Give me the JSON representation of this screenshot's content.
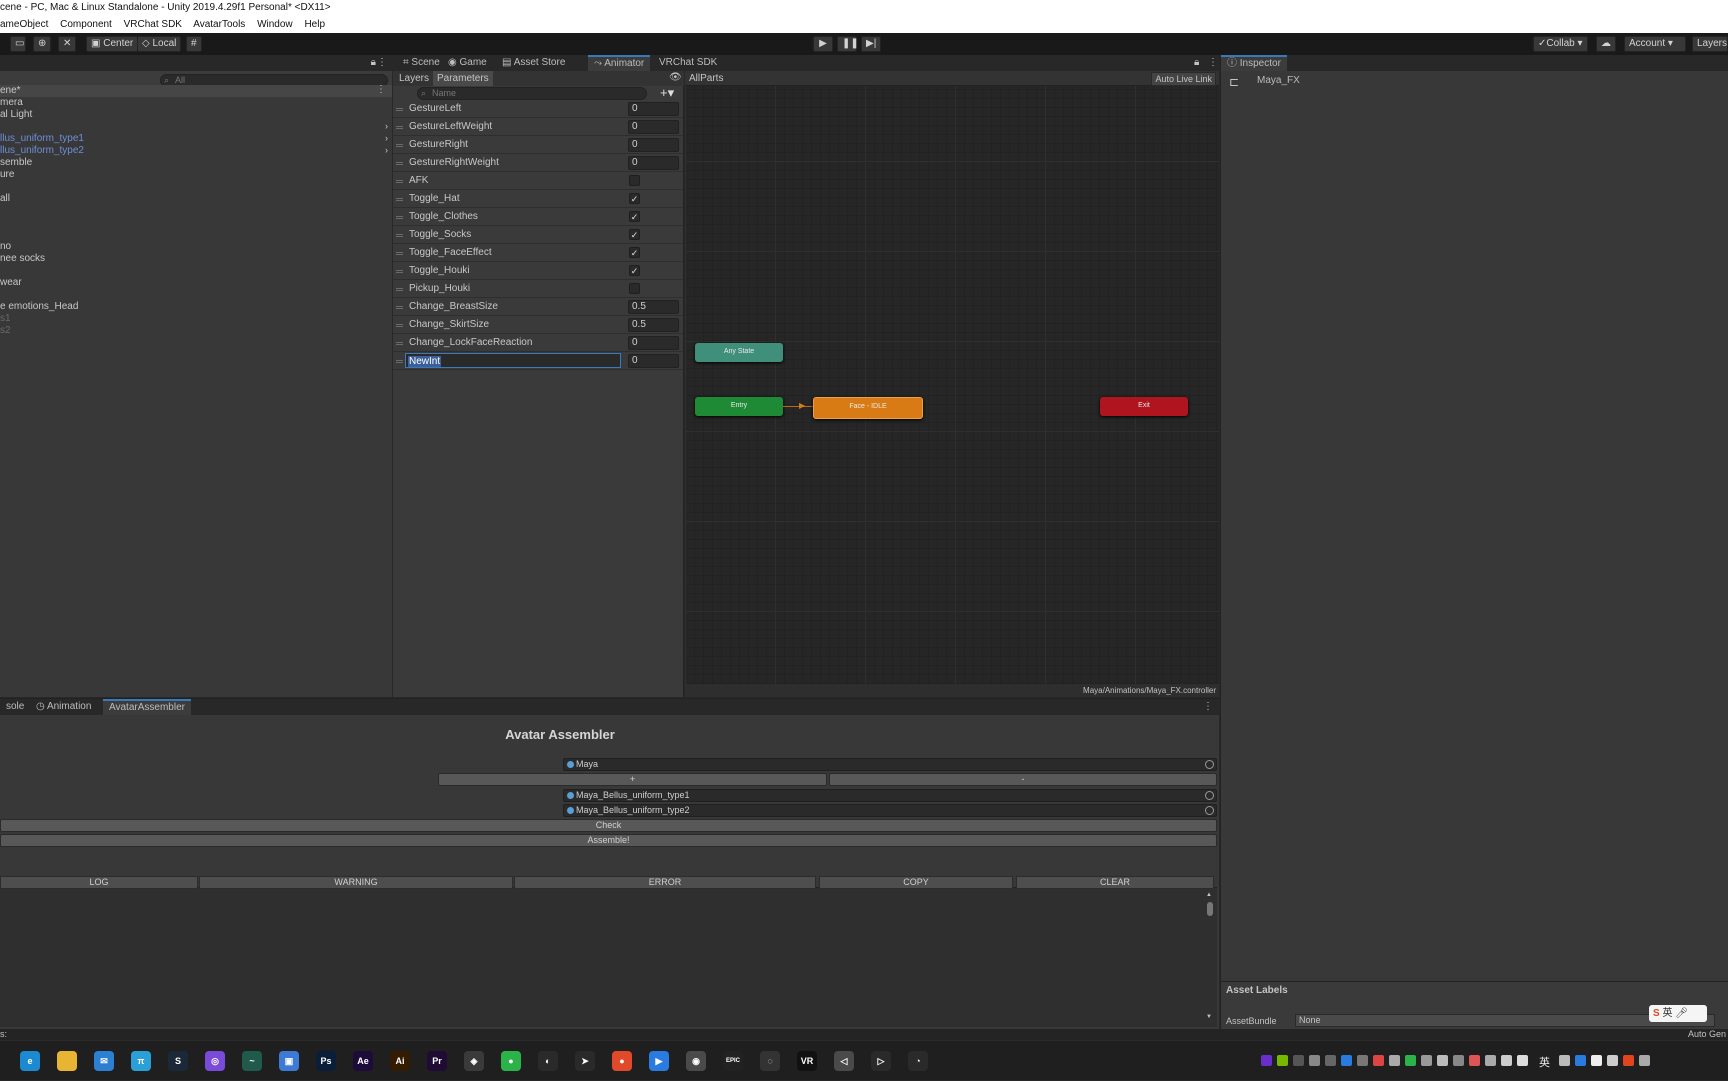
{
  "window": {
    "title": "cene - PC, Mac & Linux Standalone - Unity 2019.4.29f1 Personal* <DX11>"
  },
  "menu": [
    "ameObject",
    "Component",
    "VRChat SDK",
    "AvatarTools",
    "Window",
    "Help"
  ],
  "toolbar": {
    "pivot_center": "Center",
    "pivot_local": "Local",
    "collab": "Collab",
    "account": "Account",
    "layers": "Layers"
  },
  "hierarchy": {
    "search_placeholder": "All",
    "items": [
      {
        "label": "ene*",
        "style": "scene"
      },
      {
        "label": "mera",
        "style": "normal"
      },
      {
        "label": "al Light",
        "style": "normal"
      },
      {
        "label": "llus_uniform_type1",
        "style": "prefab"
      },
      {
        "label": "llus_uniform_type2",
        "style": "prefab"
      },
      {
        "label": "semble",
        "style": "normal"
      },
      {
        "label": "ure",
        "style": "normal"
      },
      {
        "label": "all",
        "style": "normal"
      },
      {
        "label": "no",
        "style": "normal"
      },
      {
        "label": "nee socks",
        "style": "normal"
      },
      {
        "label": "wear",
        "style": "normal"
      },
      {
        "label": "e emotions_Head",
        "style": "normal"
      },
      {
        "label": "s1",
        "style": "dim"
      },
      {
        "label": "s2",
        "style": "dim"
      }
    ]
  },
  "center_tabs": [
    "Scene",
    "Game",
    "Asset Store",
    "Animator",
    "VRChat SDK"
  ],
  "animator": {
    "subtabs": [
      "Layers",
      "Parameters"
    ],
    "search_placeholder": "Name",
    "breadcrumb": "AllParts",
    "auto_live_link": "Auto Live Link",
    "footer_path": "Maya/Animations/Maya_FX.controller",
    "parameters": [
      {
        "name": "GestureLeft",
        "type": "int",
        "value": "0"
      },
      {
        "name": "GestureLeftWeight",
        "type": "float",
        "value": "0"
      },
      {
        "name": "GestureRight",
        "type": "int",
        "value": "0"
      },
      {
        "name": "GestureRightWeight",
        "type": "float",
        "value": "0"
      },
      {
        "name": "AFK",
        "type": "bool",
        "value": ""
      },
      {
        "name": "Toggle_Hat",
        "type": "bool",
        "value": "✓"
      },
      {
        "name": "Toggle_Clothes",
        "type": "bool",
        "value": "✓"
      },
      {
        "name": "Toggle_Socks",
        "type": "bool",
        "value": "✓"
      },
      {
        "name": "Toggle_FaceEffect",
        "type": "bool",
        "value": "✓"
      },
      {
        "name": "Toggle_Houki",
        "type": "bool",
        "value": "✓"
      },
      {
        "name": "Pickup_Houki",
        "type": "bool",
        "value": ""
      },
      {
        "name": "Change_BreastSize",
        "type": "float",
        "value": "0.5"
      },
      {
        "name": "Change_SkirtSize",
        "type": "float",
        "value": "0.5"
      },
      {
        "name": "Change_LockFaceReaction",
        "type": "int",
        "value": "0"
      },
      {
        "name": "NewInt",
        "type": "int",
        "value": "0",
        "editing": true
      }
    ],
    "nodes": {
      "any_state": "Any State",
      "entry": "Entry",
      "face_idle": "Face - IDLE",
      "exit": "Exit"
    }
  },
  "inspector": {
    "tab": "Inspector",
    "object_name": "Maya_FX",
    "asset_labels": "Asset Labels",
    "assetbundle_label": "AssetBundle",
    "assetbundle_value": "None"
  },
  "bottom_tabs": [
    "sole",
    "Animation",
    "AvatarAssembler"
  ],
  "assembler": {
    "title": "Avatar Assembler",
    "base_object": "Maya",
    "plus": "+",
    "minus": "-",
    "parts": [
      "Maya_Bellus_uniform_type1",
      "Maya_Bellus_uniform_type2"
    ],
    "check_button": "Check",
    "assemble_button": "Assemble!",
    "log_buttons": [
      "LOG",
      "WARNING",
      "ERROR",
      "COPY",
      "CLEAR"
    ]
  },
  "statusbar": {
    "left": "s:",
    "right": "Auto Gen"
  },
  "ime": {
    "lang": "英"
  },
  "taskbar": {
    "tray_lang": "英",
    "apps": [
      {
        "name": "edge-icon",
        "color": "#1b8ad1",
        "glyph": "e"
      },
      {
        "name": "folder-icon",
        "color": "#e7b533",
        "glyph": ""
      },
      {
        "name": "mail-icon",
        "color": "#2d7fd1",
        "glyph": "✉"
      },
      {
        "name": "pi-icon",
        "color": "#2aa0d6",
        "glyph": "π"
      },
      {
        "name": "steam-icon",
        "color": "#1b2838",
        "glyph": "S"
      },
      {
        "name": "chat-icon",
        "color": "#7a4bd8",
        "glyph": "◎"
      },
      {
        "name": "wave-icon",
        "color": "#1f5a4c",
        "glyph": "~"
      },
      {
        "name": "window-icon",
        "color": "#3c7ad6",
        "glyph": "▣"
      },
      {
        "name": "photoshop-icon",
        "color": "#0a1e3a",
        "glyph": "Ps"
      },
      {
        "name": "aftereffects-icon",
        "color": "#1d0b3a",
        "glyph": "Ae"
      },
      {
        "name": "illustrator-icon",
        "color": "#331c00",
        "glyph": "Ai"
      },
      {
        "name": "premiere-icon",
        "color": "#1f0b33",
        "glyph": "Pr"
      },
      {
        "name": "unity-hub-icon",
        "color": "#3a3a3a",
        "glyph": "◈"
      },
      {
        "name": "wechat-icon",
        "color": "#2bb34a",
        "glyph": "●"
      },
      {
        "name": "qq-icon",
        "color": "#2a2a2a",
        "glyph": "◐"
      },
      {
        "name": "cursor-icon",
        "color": "#2a2a2a",
        "glyph": "➤"
      },
      {
        "name": "record-icon",
        "color": "#e04a2a",
        "glyph": "●"
      },
      {
        "name": "blue-app-icon",
        "color": "#2a7be0",
        "glyph": "▶"
      },
      {
        "name": "browser-icon",
        "color": "#4a4a4a",
        "glyph": "◉"
      },
      {
        "name": "epic-icon",
        "color": "#222",
        "glyph": "EPIC"
      },
      {
        "name": "sync-icon",
        "color": "#333",
        "glyph": "◌"
      },
      {
        "name": "vr-icon",
        "color": "#111",
        "glyph": "VR"
      },
      {
        "name": "unity-icon",
        "color": "#4a4a4a",
        "glyph": "◁"
      },
      {
        "name": "play-app-icon",
        "color": "#2a2a2a",
        "glyph": "▷"
      },
      {
        "name": "meter-icon",
        "color": "#2a2a2a",
        "glyph": "◔"
      }
    ]
  },
  "colors": {
    "accent": "#3a79bb",
    "any_state": "#3f8f7b",
    "entry": "#1e8a35",
    "state": "#d97b14",
    "exit": "#b0141e"
  }
}
